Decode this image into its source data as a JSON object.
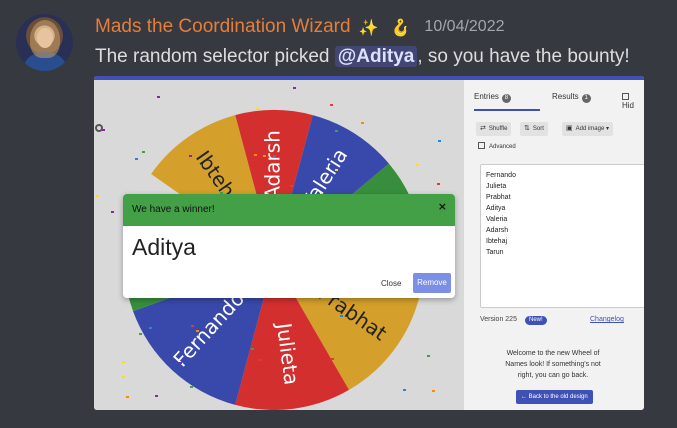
{
  "message": {
    "username": "Mads the Coordination Wizard",
    "emoji_1": "✨",
    "emoji_2": "🪝",
    "timestamp": "10/04/2022",
    "text_before": "The random selector picked ",
    "mention": "@Aditya",
    "text_after": ", so you have the bounty!",
    "colors": {
      "username": "#e67e3a",
      "mention_bg": "#414675"
    }
  },
  "wheel": {
    "segments": [
      {
        "label": "Adarsh",
        "color": "#d32f2f"
      },
      {
        "label": "Valeria",
        "color": "#3949ab"
      },
      {
        "label": "Prabhat",
        "color": "#d4a02b"
      },
      {
        "label": "Julieta",
        "color": "#d32f2f"
      },
      {
        "label": "Fernando",
        "color": "#3949ab"
      },
      {
        "label": "Ibtehaj",
        "color": "#d4a02b"
      }
    ],
    "extra_color": "#388e3c"
  },
  "panel": {
    "tab_entries": "Entries",
    "tab_entries_count": "8",
    "tab_results": "Results",
    "tab_results_count": "1",
    "tab_hide": "Hid",
    "shuffle": "Shuffle",
    "sort": "Sort",
    "add_image": "Add image",
    "advanced": "Advanced",
    "entries": [
      "Fernando",
      "Julieta",
      "Prabhat",
      "Aditya",
      "Valeria",
      "Adarsh",
      "Ibtehaj",
      "Tarun"
    ],
    "version": "Version 225",
    "new_badge": "New!",
    "changelog": "Changelog",
    "welcome_text": "Welcome to the new Wheel of Names look! If something's not right, you can go back.",
    "old_design_button": "Back to the old design"
  },
  "dialog": {
    "title": "We have a winner!",
    "close_x": "×",
    "winner": "Aditya",
    "close_label": "Close",
    "remove_label": "Remove",
    "colors": {
      "header": "#43a047",
      "remove": "#7b8fe6"
    }
  }
}
